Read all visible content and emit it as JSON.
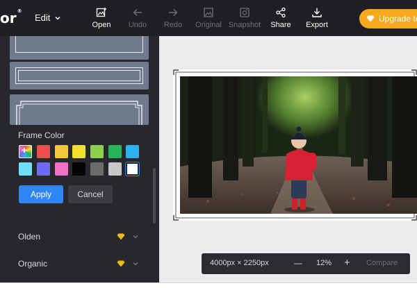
{
  "app": {
    "logo_text": "or",
    "logo_mark": "®"
  },
  "toolbar": {
    "edit_label": "Edit",
    "items": [
      {
        "label": "Open",
        "icon": "image-plus-icon",
        "enabled": true
      },
      {
        "label": "Undo",
        "icon": "arrow-left-icon",
        "enabled": false
      },
      {
        "label": "Redo",
        "icon": "arrow-right-icon",
        "enabled": false
      },
      {
        "label": "Original",
        "icon": "image-icon",
        "enabled": false
      },
      {
        "label": "Snapshot",
        "icon": "snapshot-icon",
        "enabled": false
      },
      {
        "label": "Share",
        "icon": "share-icon",
        "enabled": true
      },
      {
        "label": "Export",
        "icon": "download-icon",
        "enabled": true
      }
    ],
    "upgrade_label": "Upgrade to"
  },
  "sidebar": {
    "frame_color_label": "Frame Color",
    "swatches": [
      "custom",
      "#f04d4d",
      "#f5c53b",
      "#f2e02e",
      "#8fd14f",
      "#26b35a",
      "#2bb2f0",
      "#6fe0f5",
      "#6d6cf5",
      "#f070c6",
      "#050505",
      "#6b6b6b",
      "#c8c8c8",
      "#ffffff"
    ],
    "selected_swatch_index": 13,
    "apply_label": "Apply",
    "cancel_label": "Cancel",
    "categories": [
      {
        "label": "Olden",
        "premium": true
      },
      {
        "label": "Organic",
        "premium": true
      }
    ]
  },
  "status": {
    "dimensions": "4000px × 2250px",
    "zoom": "12%",
    "minus": "—",
    "plus": "+",
    "compare_label": "Compare"
  },
  "colors": {
    "topbar": "#1f2023",
    "sidebar": "#27282b",
    "accent_blue": "#2f86f6",
    "upgrade_orange": "#f6a81e",
    "premium_gem": "#f2b51e"
  }
}
